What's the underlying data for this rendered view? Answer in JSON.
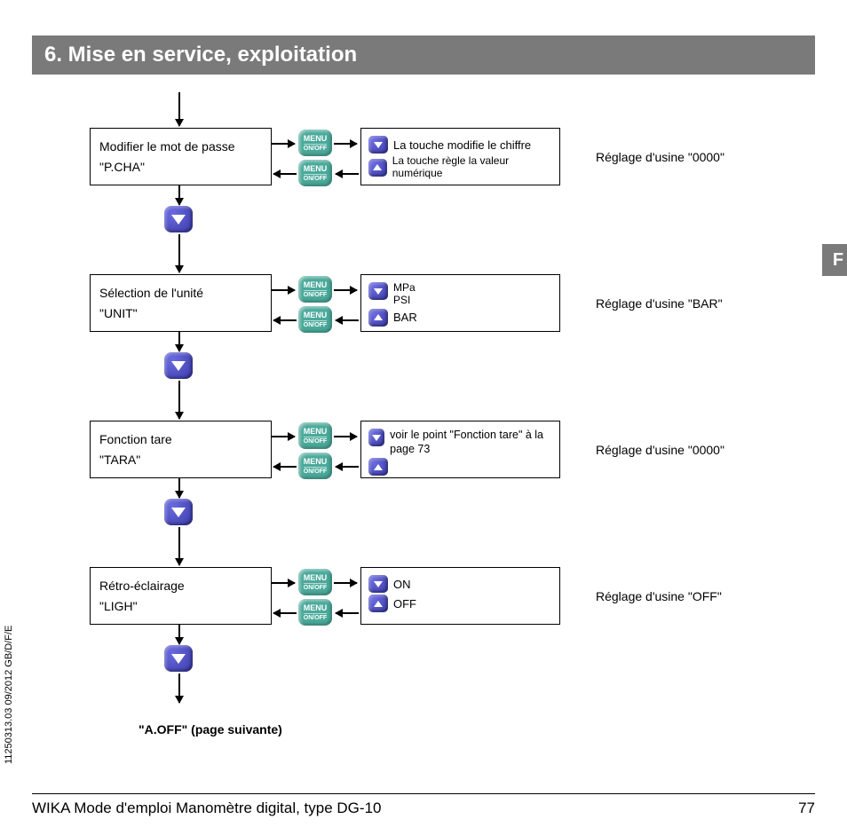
{
  "header": "6. Mise en service, exploitation",
  "buttons": {
    "menu_top": "MENU",
    "menu_bottom": "ON/OFF"
  },
  "steps": [
    {
      "title": "Modifier le mot de passe",
      "code": "\"P.CHA\"",
      "opt1": "La touche modifie le chiffre",
      "opt2": "La touche règle la valeur numérique",
      "factory": "Réglage d'usine \"0000\"",
      "mode": "twoicons"
    },
    {
      "title": "Sélection de l'unité",
      "code": "\"UNIT\"",
      "u1": "MPa",
      "u2": "PSI",
      "u3": "BAR",
      "factory": "Réglage d'usine \"BAR\"",
      "mode": "units"
    },
    {
      "title": "Fonction tare",
      "code": "\"TARA\"",
      "opt1": "voir le point \"Fonction tare\" à la page 73",
      "factory": "Réglage d'usine \"0000\"",
      "mode": "tara"
    },
    {
      "title": "Rétro-éclairage",
      "code": "\"LIGH\"",
      "u1": "ON",
      "u2": "OFF",
      "factory": "Réglage d'usine \"OFF\"",
      "mode": "onoff"
    }
  ],
  "next": "\"A.OFF\" (page suivante)",
  "footer": {
    "title": "WIKA Mode d'emploi Manomètre digital, type DG-10",
    "page": "77"
  },
  "docref": "11250313.03 09/2012 GB/D/F/E",
  "lang": "F"
}
